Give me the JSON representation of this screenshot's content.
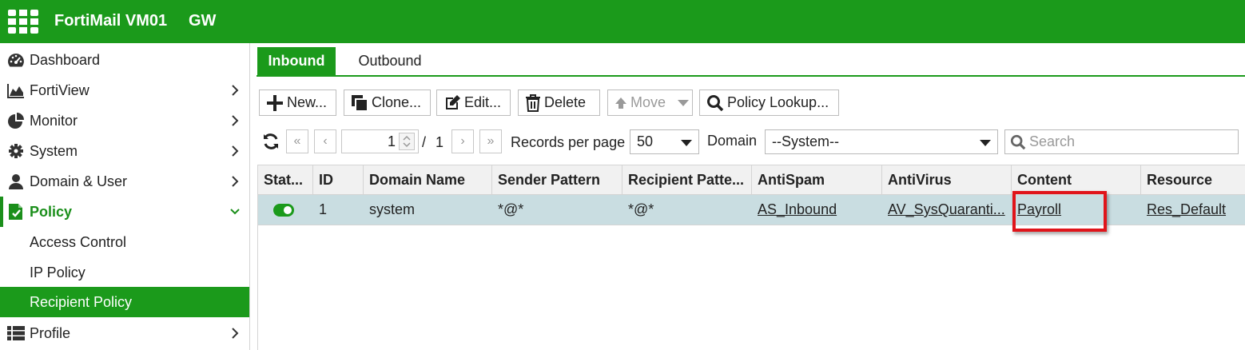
{
  "header": {
    "product_name": "FortiMail VM01",
    "mode": "GW",
    "brand_color": "#1b9a1b",
    "logo_icon": "fortinet-logo-icon"
  },
  "sidebar": {
    "items": [
      {
        "label": "Dashboard",
        "icon": "dashboard-icon",
        "has_chevron": false
      },
      {
        "label": "FortiView",
        "icon": "area-chart-icon",
        "has_chevron": true
      },
      {
        "label": "Monitor",
        "icon": "pie-chart-icon",
        "has_chevron": true
      },
      {
        "label": "System",
        "icon": "gear-icon",
        "has_chevron": true
      },
      {
        "label": "Domain & User",
        "icon": "user-icon",
        "has_chevron": true
      },
      {
        "label": "Policy",
        "icon": "policy-document-icon",
        "has_chevron": true,
        "expanded": true
      },
      {
        "label": "Profile",
        "icon": "list-icon",
        "has_chevron": true
      }
    ],
    "policy_subitems": [
      {
        "label": "Access Control"
      },
      {
        "label": "IP Policy"
      },
      {
        "label": "Recipient Policy",
        "selected": true
      }
    ]
  },
  "tabs": [
    {
      "label": "Inbound",
      "active": true
    },
    {
      "label": "Outbound",
      "active": false
    }
  ],
  "toolbar": {
    "new_label": "New...",
    "clone_label": "Clone...",
    "edit_label": "Edit...",
    "delete_label": "Delete",
    "move_label": "Move",
    "lookup_label": "Policy Lookup..."
  },
  "pagination": {
    "current_page": "1",
    "separator": "/",
    "total_pages": "1",
    "records_label": "Records per page",
    "records_value": "50",
    "domain_label": "Domain",
    "domain_value": "--System--",
    "search_placeholder": "Search"
  },
  "table": {
    "columns": [
      "Stat...",
      "ID",
      "Domain Name",
      "Sender Pattern",
      "Recipient Patte...",
      "AntiSpam",
      "AntiVirus",
      "Content",
      "Resource"
    ],
    "rows": [
      {
        "status": "enabled",
        "id": "1",
        "domain": "system",
        "sender": "*@*",
        "recipient": "*@*",
        "antispam": "AS_Inbound",
        "antivirus": "AV_SysQuaranti...",
        "content": "Payroll",
        "resource": "Res_Default"
      }
    ]
  },
  "colors": {
    "row_selected": "#c9dde1",
    "highlight_box": "#e0141a"
  }
}
